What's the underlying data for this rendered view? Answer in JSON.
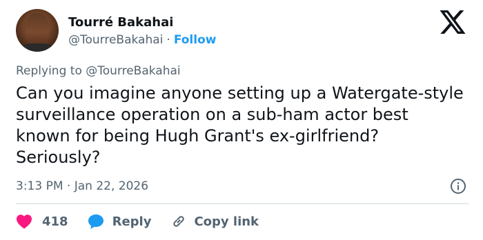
{
  "author": {
    "name": "Tourré Bakahai",
    "handle": "@TourreBakahai",
    "separator": "·",
    "follow_label": "Follow"
  },
  "reply_context": {
    "prefix": "Replying to",
    "handle": "@TourreBakahai"
  },
  "tweet": {
    "text": "Can you imagine anyone setting up a Watergate-style surveillance operation on a sub-ham actor best known for being Hugh Grant's ex-girlfriend? Seriously?",
    "timestamp": "3:13 PM · Jan 22, 2026"
  },
  "actions": {
    "like_count": "418",
    "reply_label": "Reply",
    "copy_link_label": "Copy link"
  },
  "icons": {
    "brand": "x-logo-icon",
    "info": "info-icon",
    "like": "heart-icon",
    "reply": "speech-bubble-icon",
    "copy": "link-icon"
  },
  "colors": {
    "text": "#0f1419",
    "secondary": "#536471",
    "accent": "#1d9bf0",
    "like": "#f91880",
    "divider": "#cfd9de"
  }
}
